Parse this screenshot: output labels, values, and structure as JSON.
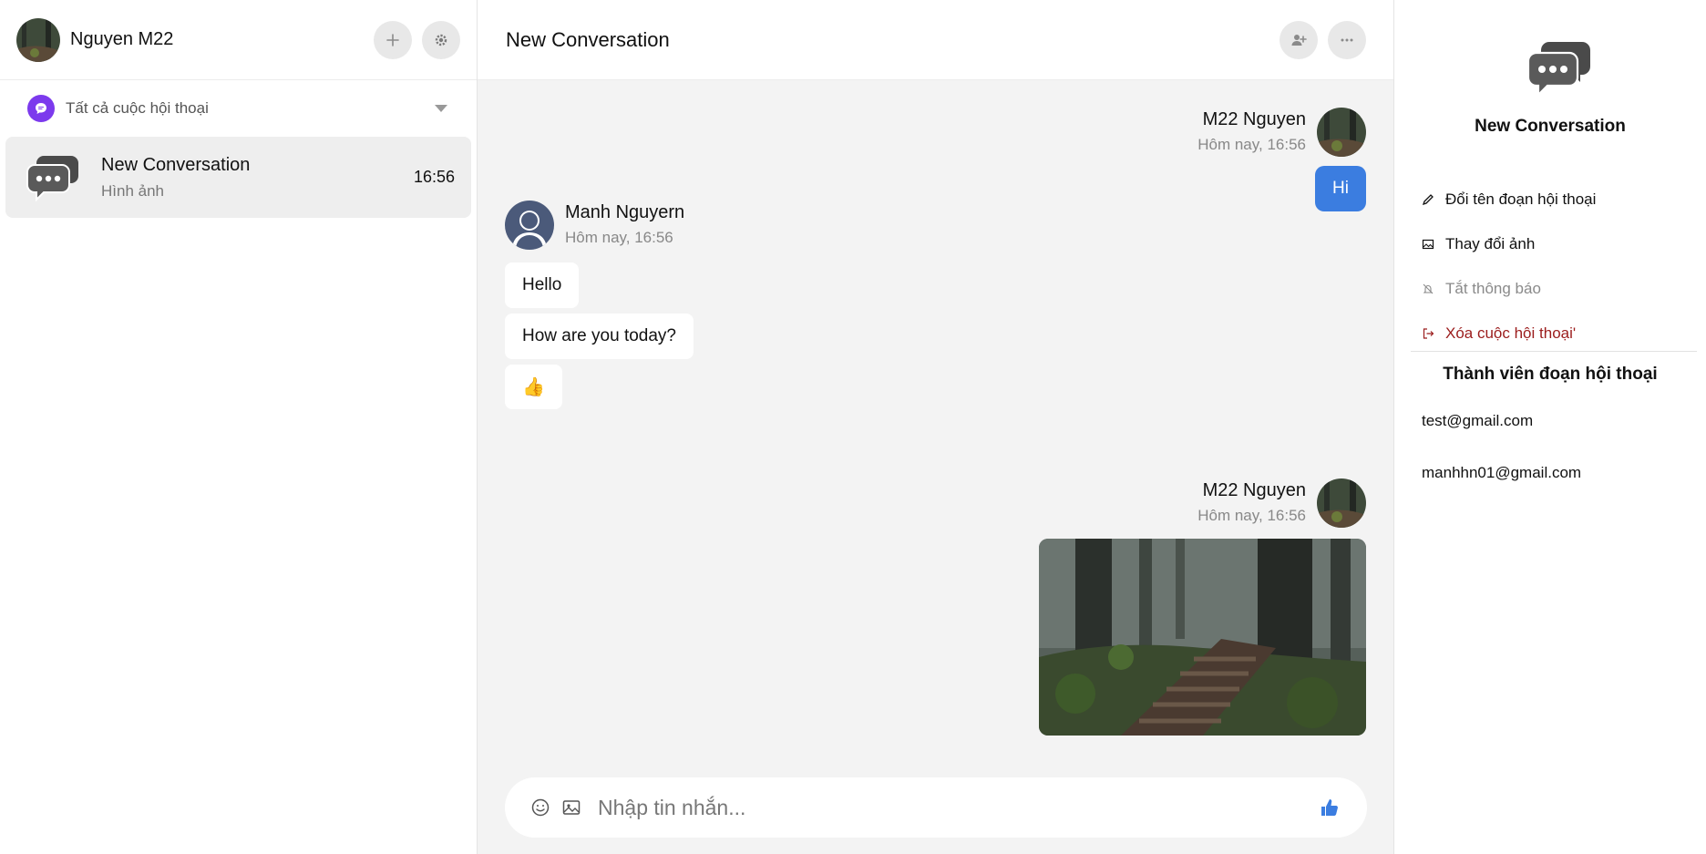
{
  "user": {
    "name": "Nguyen M22"
  },
  "sidebar": {
    "filter_label": "Tất cả cuộc hội thoại",
    "conversations": [
      {
        "name": "New Conversation",
        "preview": "Hình ảnh",
        "time": "16:56"
      }
    ]
  },
  "chat": {
    "title": "New Conversation",
    "messages": [
      {
        "sender": "M22 Nguyen",
        "time": "Hôm nay, 16:56",
        "side": "right",
        "texts": [
          "Hi"
        ]
      },
      {
        "sender": "Manh Nguyern",
        "time": "Hôm nay, 16:56",
        "side": "left",
        "texts": [
          "Hello",
          "How are you today?",
          "👍"
        ]
      },
      {
        "sender": "M22 Nguyen",
        "time": "Hôm nay, 16:56",
        "side": "right",
        "attachment": "image"
      }
    ],
    "composer_placeholder": "Nhập tin nhắn..."
  },
  "panel": {
    "title": "New Conversation",
    "menu": [
      {
        "label": "Đổi tên đoạn hội thoại",
        "icon": "pencil-icon"
      },
      {
        "label": "Thay đổi ảnh",
        "icon": "image-icon"
      },
      {
        "label": "Tắt thông báo",
        "icon": "bell-off-icon"
      },
      {
        "label": "Xóa cuộc hội thoại'",
        "icon": "logout-icon"
      }
    ],
    "members_title": "Thành viên đoạn hội thoại",
    "members": [
      "test@gmail.com",
      "manhhn01@gmail.com"
    ]
  },
  "colors": {
    "accent": "#3b7de0",
    "filter_badge": "#7c3aed",
    "danger": "#9b1c1c"
  }
}
